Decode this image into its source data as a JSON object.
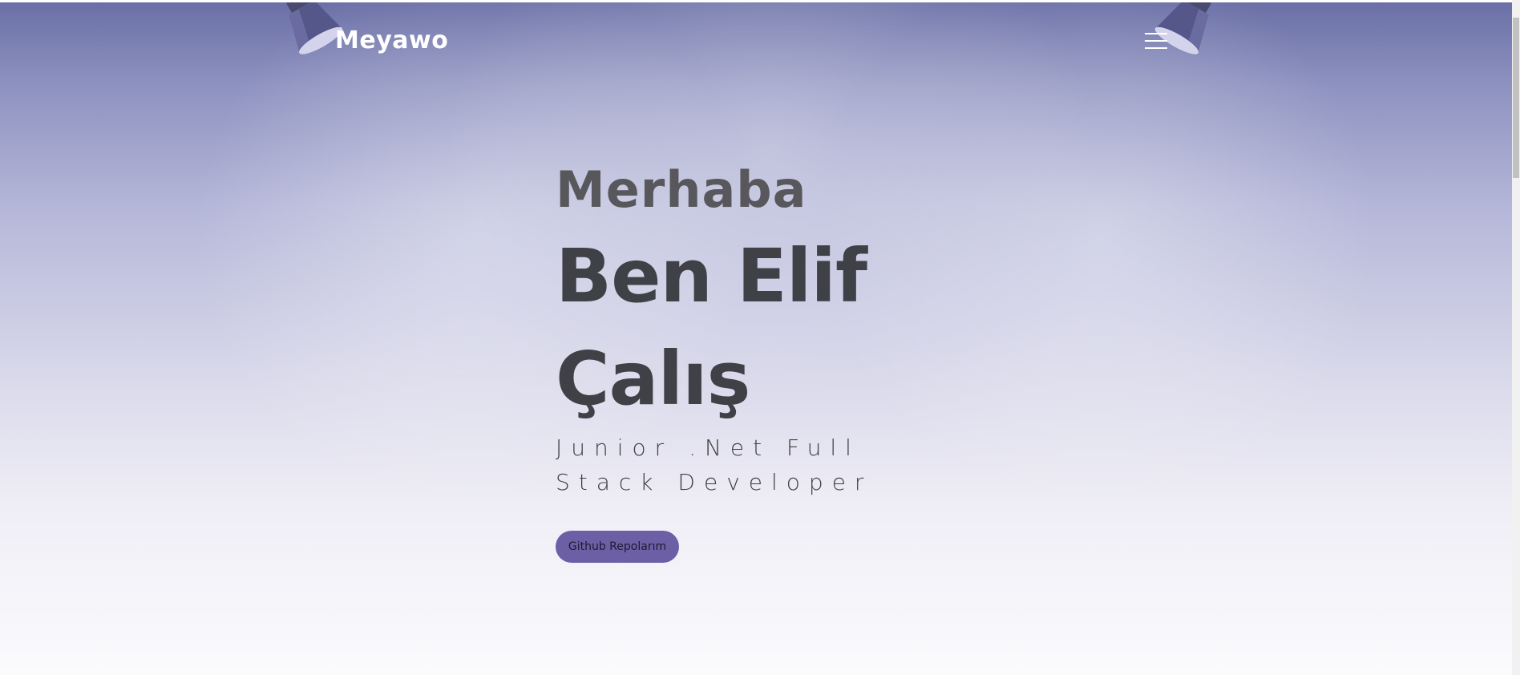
{
  "header": {
    "logo": "Meyawo",
    "menu_icon": "hamburger-icon"
  },
  "hero": {
    "greeting": "Merhaba",
    "name_line1": "Ben Elif",
    "name_line2": "Çalış",
    "role_line1": "Junior .Net Full",
    "role_line2": "Stack Developer",
    "cta_label": "Github Repolarım"
  },
  "decor": {
    "lamp_left": "spotlight-icon",
    "lamp_right": "spotlight-icon"
  },
  "colors": {
    "background_top": "#6a6fa6",
    "background_bottom": "#fbfbfd",
    "text_dark": "#3f4147",
    "accent": "#6c5fa6"
  }
}
